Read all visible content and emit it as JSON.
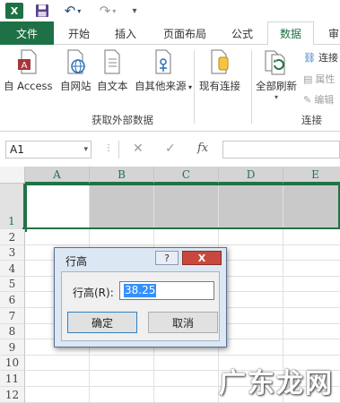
{
  "quick_access": {
    "logo_letter": "X",
    "save_icon": "save-icon",
    "undo_icon": "undo-icon",
    "redo_icon": "redo-icon"
  },
  "tabs": [
    {
      "label": "文件",
      "id": "file"
    },
    {
      "label": "开始",
      "id": "home"
    },
    {
      "label": "插入",
      "id": "insert"
    },
    {
      "label": "页面布局",
      "id": "page-layout"
    },
    {
      "label": "公式",
      "id": "formulas"
    },
    {
      "label": "数据",
      "id": "data"
    },
    {
      "label": "审阅",
      "id": "review"
    }
  ],
  "ribbon": {
    "get_external_data": {
      "label": "获取外部数据",
      "buttons": [
        "自 Access",
        "自网站",
        "自文本",
        "自其他来源"
      ]
    },
    "existing_connections": "现有连接",
    "refresh_all": "全部刷新",
    "connections_group": {
      "label": "连接",
      "items": [
        "连接",
        "属性",
        "编辑"
      ]
    }
  },
  "formula_bar": {
    "name_box": "A1",
    "fx_label": "fx",
    "formula_value": ""
  },
  "grid": {
    "columns": [
      "A",
      "B",
      "C",
      "D",
      "E"
    ],
    "rows": [
      "1",
      "2",
      "3",
      "4",
      "5",
      "6",
      "7",
      "8",
      "9",
      "10",
      "11",
      "12"
    ]
  },
  "dialog": {
    "title": "行高",
    "help": "?",
    "close": "X",
    "field_label": "行高(R):",
    "field_value": "38.25",
    "ok": "确定",
    "cancel": "取消"
  },
  "watermark": "广东龙网",
  "colors": {
    "excel_green": "#1e7145",
    "selection_green": "#217346",
    "dialog_frame": "#dce7f4",
    "close_red": "#c9483e"
  }
}
